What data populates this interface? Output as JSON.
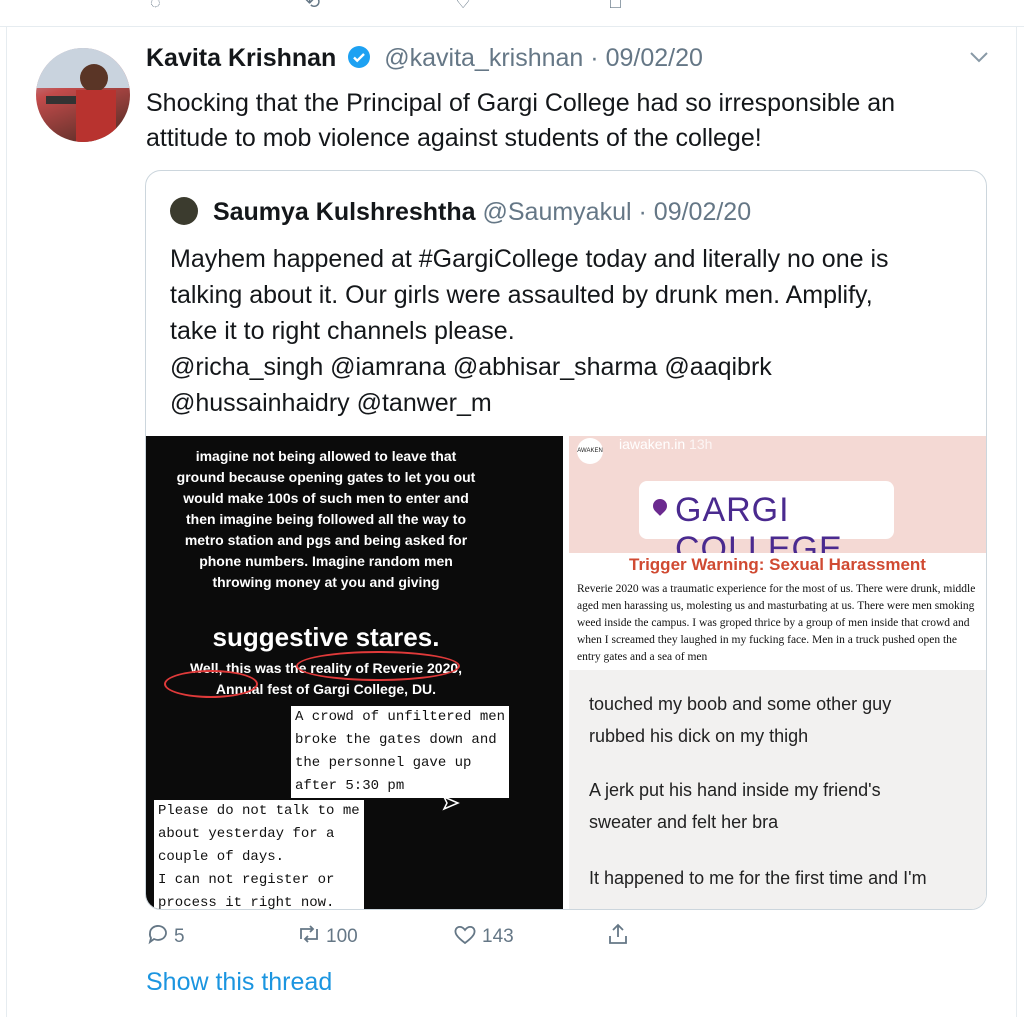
{
  "tweet": {
    "author_name": "Kavita Krishnan",
    "handle": "@kavita_krishnan",
    "date": "09/02/20",
    "text": "Shocking that the Principal of Gargi College had so irresponsible an attitude to mob violence against students of the college!",
    "replies": "5",
    "retweets": "100",
    "likes": "143",
    "show_thread": "Show this thread"
  },
  "quote": {
    "author_name": "Saumya Kulshreshtha",
    "handle": "@Saumyakul",
    "date": "09/02/20",
    "text_lines": [
      "Mayhem happened at #GargiCollege today and literally no one is",
      "talking about it. Our girls were assaulted by drunk men. Amplify,",
      "take it to right channels please.",
      "@richa_singh @iamrana @abhisar_sharma @aaqibrk",
      "@hussainhaidry @tanwer_m"
    ]
  },
  "left_image": {
    "paragraph": "imagine not being allowed to leave that ground because opening gates to let you out would make 100s of such men to enter and then imagine being followed all the way to metro station and pgs and being asked for phone numbers. Imagine random men throwing money at you and giving",
    "big": "suggestive stares.",
    "bottom": "Well, this was the reality of Reverie 2020, Annual fest of Gargi College, DU.",
    "box1": "A crowd of unfiltered men\nbroke the gates down and\nthe personnel gave up\nafter 5:30 pm",
    "box2": "Please do not talk to me\nabout yesterday for a\ncouple of days.\nI can not register or\nprocess it right now."
  },
  "right_image": {
    "username": "iawaken.in",
    "time": "13h",
    "avatar_text": "AWAKEN",
    "location": "GARGI COLLEGE",
    "warning_title": "Trigger Warning: Sexual Harassment",
    "warning_body": "Reverie 2020 was a traumatic experience for the most of us. There were drunk, middle aged men harassing us, molesting us and masturbating at us. There were men smoking weed inside the campus. I was groped thrice by a group of men inside that crowd and when I screamed they laughed in my fucking face. Men in a truck pushed open the entry gates and a sea of men",
    "line1": "touched my boob and some other guy",
    "line2": "rubbed his dick on my thigh",
    "line3": "A jerk put his hand inside my friend's",
    "line4": "sweater and felt her bra",
    "line5": "It happened to me for the first time and I'm"
  },
  "colors": {
    "link": "#1b95e0",
    "meta": "#657786",
    "verified": "#1da1f2"
  }
}
